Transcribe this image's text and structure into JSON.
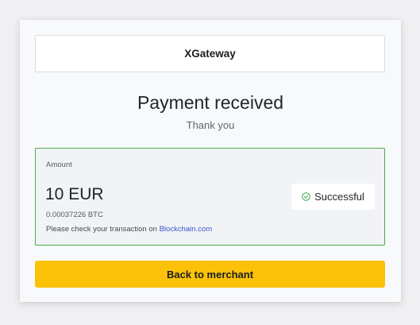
{
  "header": {
    "brand_name": "XGateway"
  },
  "main": {
    "title": "Payment received",
    "subtitle": "Thank you"
  },
  "payment": {
    "amount_label": "Amount",
    "amount": "10 EUR",
    "btc_amount": "0.00037226 BTC",
    "check_text": "Please check your transaction on",
    "check_link": "Blockchain.com",
    "status": "Successful",
    "status_icon": "check-circle-icon"
  },
  "actions": {
    "back_label": "Back to merchant"
  },
  "colors": {
    "accent_button": "#fbc209",
    "success_border": "#4cae4f",
    "success_icon": "#3fae4a",
    "link": "#3a55c8"
  }
}
